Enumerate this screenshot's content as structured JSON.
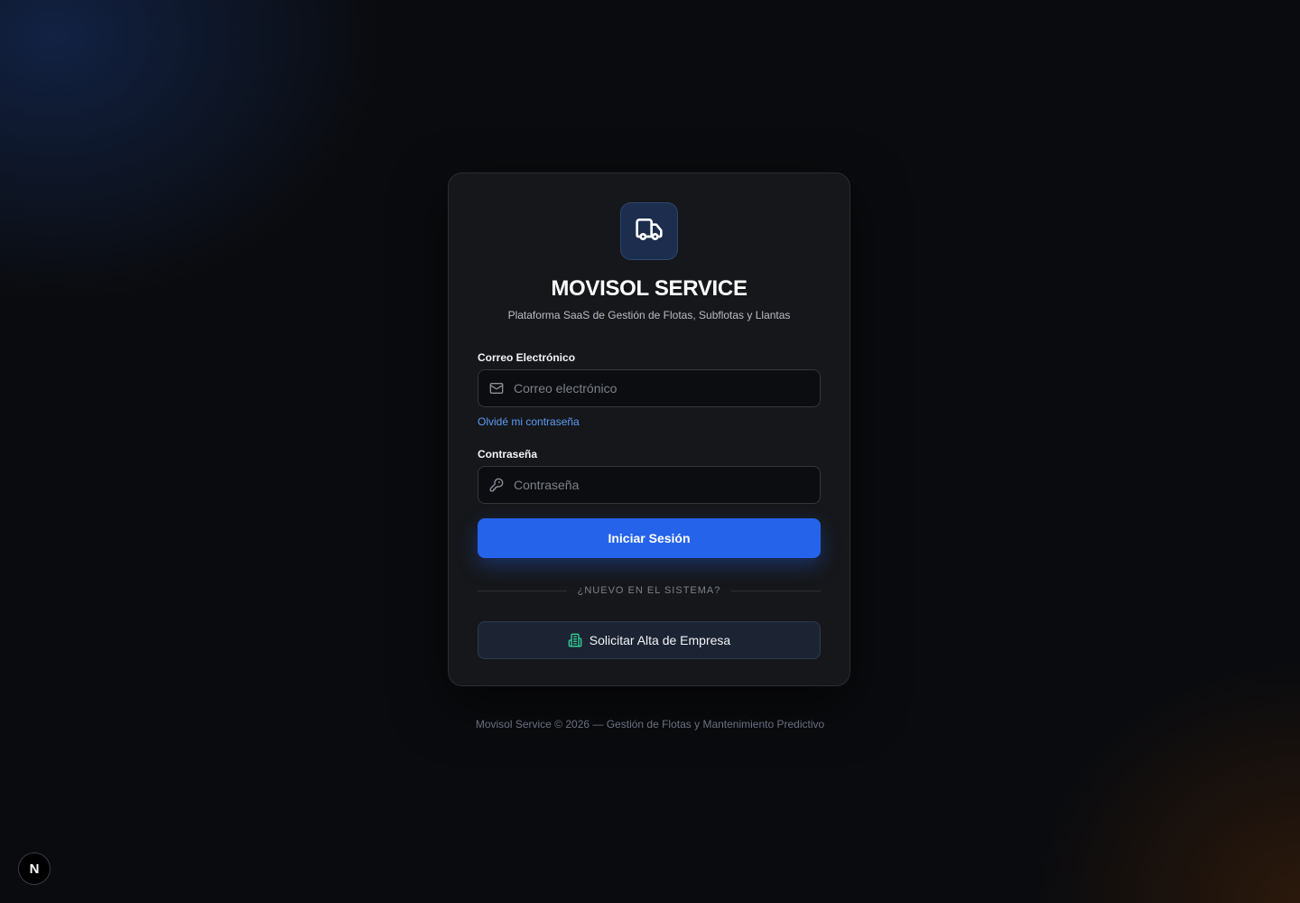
{
  "brand": {
    "title": "MOVISOL SERVICE",
    "subtitle": "Plataforma SaaS de Gestión de Flotas, Subflotas y Llantas",
    "logo_icon": "truck-icon",
    "accent_color": "#2563eb"
  },
  "form": {
    "email_label": "Correo Electrónico",
    "email_placeholder": "Correo electrónico",
    "email_value": "",
    "email_icon": "mail-icon",
    "forgot_link": "Olvidé mi contraseña",
    "password_label": "Contraseña",
    "password_placeholder": "Contraseña",
    "password_value": "",
    "password_icon": "key-icon",
    "submit_label": "Iniciar Sesión"
  },
  "signup": {
    "divider_text": "¿NUEVO EN EL SISTEMA?",
    "button_label": "Solicitar Alta de Empresa",
    "button_icon": "building-icon",
    "icon_color": "#34d399"
  },
  "footer": {
    "text": "Movisol Service © 2026 — Gestión de Flotas y Mantenimiento Predictivo"
  },
  "dev_badge": {
    "label": "N"
  }
}
